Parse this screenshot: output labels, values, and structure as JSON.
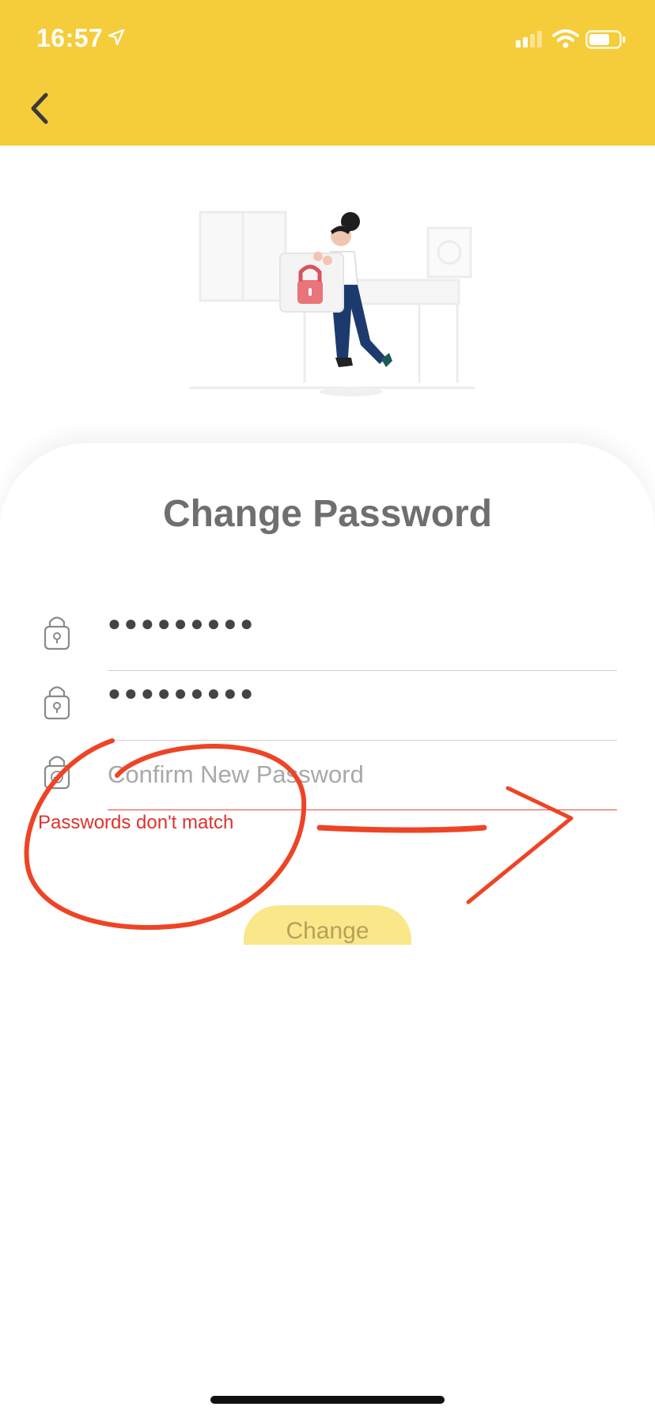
{
  "status_bar": {
    "time": "16:57"
  },
  "page": {
    "title": "Change Password"
  },
  "form": {
    "current_password": {
      "value": "●●●●●●●●●"
    },
    "new_password": {
      "value": "●●●●●●●●●"
    },
    "confirm_password": {
      "placeholder": "Confirm New Password",
      "value": ""
    },
    "error_message": "Passwords don't match",
    "submit_label": "Change"
  },
  "colors": {
    "header": "#f5cc3a",
    "button": "#f9e78a",
    "error": "#e0322a",
    "annotation": "#ee4426"
  },
  "icons": {
    "back": "chevron-left-icon",
    "field_lock": "lock-icon",
    "confirm_lock": "lock-check-icon"
  }
}
